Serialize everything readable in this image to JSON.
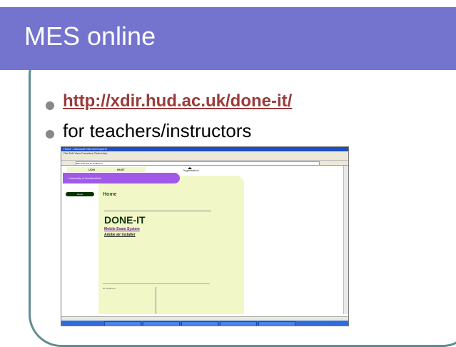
{
  "slide": {
    "title": "MES online",
    "bullets": [
      {
        "text": "http://xdir.hud.ac.uk/done-it/",
        "type": "link"
      },
      {
        "text": "for teachers/instructors",
        "type": "text"
      }
    ]
  },
  "screenshot": {
    "window_title": "Home - Microsoft Internet Explorer",
    "menu": "File  Edit  View  Favorites  Tools  Help",
    "address": "http://xdir.hud.ac.uk/done-it/",
    "tabs": [
      "UOH",
      "HUST"
    ],
    "band_text": "University of Huddersfield",
    "org_label": "Organisation",
    "home_pill": "Home",
    "home_heading": "Home",
    "main_heading": "DONE-IT",
    "link1": "Mobile Exam System",
    "link2": "Adobe air installer",
    "contact_heading": "To contact us:"
  },
  "colors": {
    "title_bar": "#7474cf",
    "frame": "#5f8c91",
    "link": "#9b3b3b",
    "panel": "#f2f7c7",
    "band": "#a15ae8"
  }
}
